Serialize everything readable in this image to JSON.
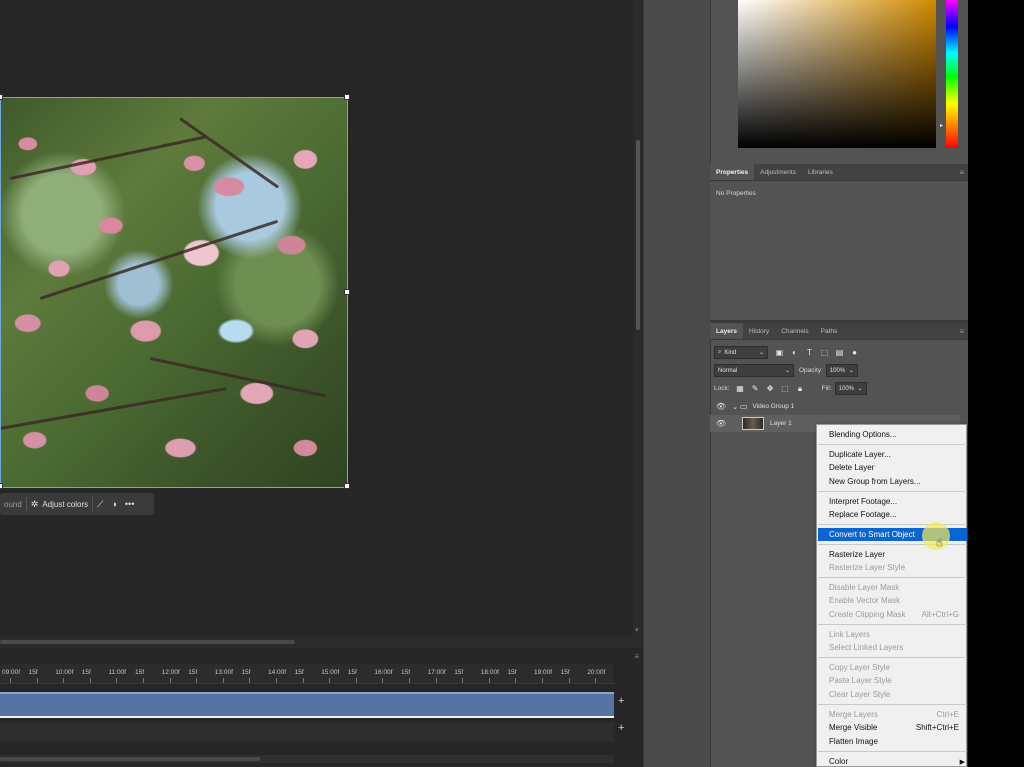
{
  "canvas": {
    "task_bar": {
      "partial_label": "ound",
      "adjust_colors_label": "Adjust colors",
      "more_label": "•••"
    }
  },
  "timeline": {
    "timecodes": [
      "09:00f",
      "15f",
      "10:00f",
      "15f",
      "11:00f",
      "15f",
      "12:00f",
      "15f",
      "13:00f",
      "15f",
      "14:00f",
      "15f",
      "15:00f",
      "15f",
      "16:00f",
      "15f",
      "17:00f",
      "15f",
      "18:00f",
      "15f",
      "19:00f",
      "15f",
      "20:00f"
    ],
    "add_track_icon": "plus-icon",
    "menu_icon": "hamburger-icon"
  },
  "color_picker": {
    "field_colors": [
      "#ffffff",
      "#d08a00",
      "#000000"
    ],
    "hue_position": "orange-red"
  },
  "properties_panel": {
    "tabs": [
      "Properties",
      "Adjustments",
      "Libraries"
    ],
    "active_tab": "Properties",
    "body_text": "No Properties"
  },
  "layers_panel": {
    "tabs": [
      "Layers",
      "History",
      "Channels",
      "Paths"
    ],
    "active_tab": "Layers",
    "filter_kind": "Kind",
    "blend_mode": "Normal",
    "opacity_label": "Opacity:",
    "opacity_value": "100%",
    "lock_label": "Lock:",
    "fill_label": "Fill:",
    "fill_value": "100%",
    "layers": [
      {
        "name": "Video Group 1",
        "type": "group"
      },
      {
        "name": "Layer 1",
        "type": "video"
      }
    ]
  },
  "context_menu": {
    "items": [
      {
        "label": "Blending Options...",
        "enabled": true,
        "shortcut": ""
      },
      {
        "label": "Duplicate Layer...",
        "enabled": true,
        "shortcut": ""
      },
      {
        "label": "Delete Layer",
        "enabled": true,
        "shortcut": ""
      },
      {
        "label": "New Group from Layers...",
        "enabled": true,
        "shortcut": ""
      },
      {
        "label": "Interpret Footage...",
        "enabled": true,
        "shortcut": ""
      },
      {
        "label": "Replace Footage...",
        "enabled": true,
        "shortcut": ""
      },
      {
        "label": "Convert to Smart Object",
        "enabled": true,
        "shortcut": "",
        "highlighted": true
      },
      {
        "label": "Rasterize Layer",
        "enabled": true,
        "shortcut": ""
      },
      {
        "label": "Rasterize Layer Style",
        "enabled": false,
        "shortcut": ""
      },
      {
        "label": "Disable Layer Mask",
        "enabled": false,
        "shortcut": ""
      },
      {
        "label": "Enable Vector Mask",
        "enabled": false,
        "shortcut": ""
      },
      {
        "label": "Create Clipping Mask",
        "enabled": false,
        "shortcut": "Alt+Ctrl+G"
      },
      {
        "label": "Link Layers",
        "enabled": false,
        "shortcut": ""
      },
      {
        "label": "Select Linked Layers",
        "enabled": false,
        "shortcut": ""
      },
      {
        "label": "Copy Layer Style",
        "enabled": false,
        "shortcut": ""
      },
      {
        "label": "Paste Layer Style",
        "enabled": false,
        "shortcut": ""
      },
      {
        "label": "Clear Layer Style",
        "enabled": false,
        "shortcut": ""
      },
      {
        "label": "Merge Layers",
        "enabled": false,
        "shortcut": "Ctrl+E"
      },
      {
        "label": "Merge Visible",
        "enabled": true,
        "shortcut": "Shift+Ctrl+E"
      },
      {
        "label": "Flatten Image",
        "enabled": true,
        "shortcut": ""
      },
      {
        "label": "Color",
        "enabled": true,
        "shortcut": "",
        "submenu": true
      }
    ],
    "highlight_color": "#0a64d2"
  },
  "colors": {
    "track_color": "#5773a3",
    "selection_color": "#6fa8dc",
    "panel_bg": "#535353"
  }
}
